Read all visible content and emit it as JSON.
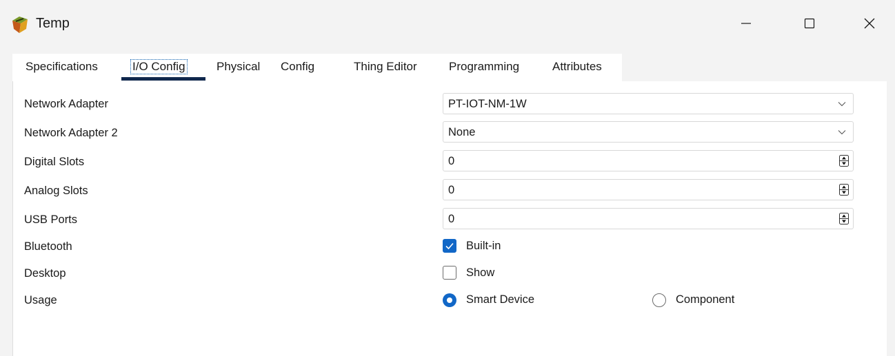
{
  "window": {
    "title": "Temp",
    "icon": "iot-device-icon",
    "controls": [
      "minimize-icon",
      "maximize-icon",
      "close-icon"
    ]
  },
  "tabs": [
    {
      "label": "Specifications",
      "selected": false
    },
    {
      "label": "I/O Config",
      "selected": true
    },
    {
      "label": "Physical",
      "selected": false
    },
    {
      "label": "Config",
      "selected": false
    },
    {
      "label": "Thing Editor",
      "selected": false
    },
    {
      "label": "Programming",
      "selected": false
    },
    {
      "label": "Attributes",
      "selected": false
    }
  ],
  "io_config": {
    "network_adapter": {
      "label": "Network Adapter",
      "value": "PT-IOT-NM-1W"
    },
    "network_adapter_2": {
      "label": "Network Adapter 2",
      "value": "None"
    },
    "digital_slots": {
      "label": "Digital Slots",
      "value": "0"
    },
    "analog_slots": {
      "label": "Analog Slots",
      "value": "0"
    },
    "usb_ports": {
      "label": "USB Ports",
      "value": "0"
    },
    "bluetooth": {
      "label": "Bluetooth",
      "option": "Built-in",
      "checked": true
    },
    "desktop": {
      "label": "Desktop",
      "option": "Show",
      "checked": false
    },
    "usage": {
      "label": "Usage",
      "options": [
        {
          "label": "Smart Device",
          "selected": true
        },
        {
          "label": "Component",
          "selected": false
        }
      ]
    }
  },
  "colors": {
    "accent": "#1167c7",
    "tab_underline": "#10284d",
    "window_bg": "#f3f3f3",
    "panel_bg": "#ffffff"
  }
}
